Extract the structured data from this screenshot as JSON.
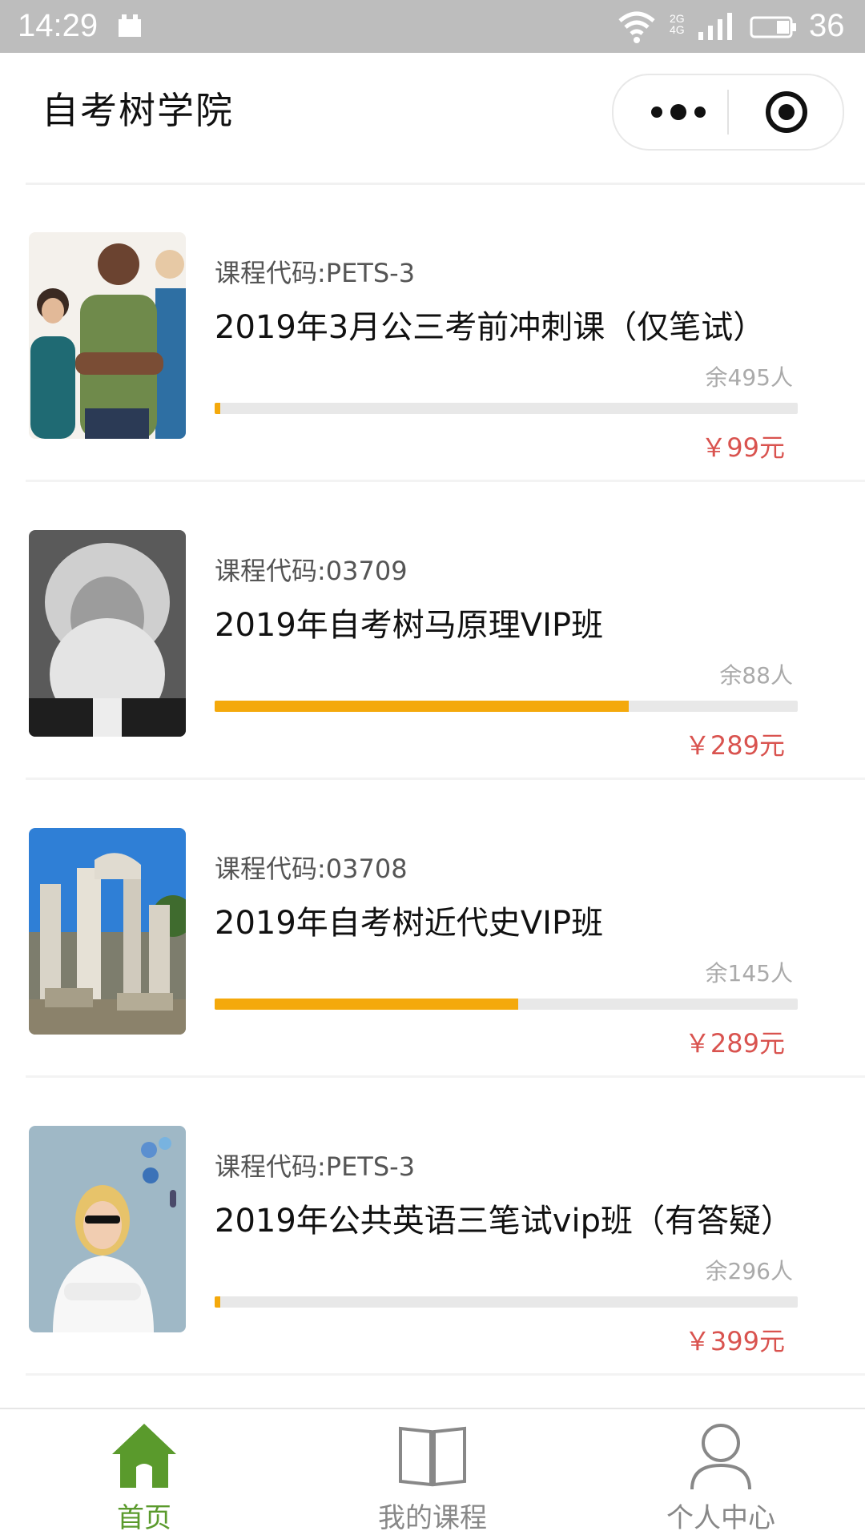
{
  "status_bar": {
    "time": "14:29",
    "network": "2G 4G",
    "battery_level": "36"
  },
  "nav": {
    "title": "自考树学院"
  },
  "courses": [
    {
      "code": "课程代码:PETS-3",
      "title": "2019年3月公三考前冲刺课（仅笔试）",
      "remaining": "余495人",
      "progress": 0.01,
      "price": "￥99元"
    },
    {
      "code": "课程代码:03709",
      "title": "2019年自考树马原理VIP班",
      "remaining": "余88人",
      "progress": 0.71,
      "price": "￥289元"
    },
    {
      "code": "课程代码:03708",
      "title": "2019年自考树近代史VIP班",
      "remaining": "余145人",
      "progress": 0.52,
      "price": "￥289元"
    },
    {
      "code": "课程代码:PETS-3",
      "title": "2019年公共英语三笔试vip班（有答疑）",
      "remaining": "余296人",
      "progress": 0.01,
      "price": "￥399元"
    }
  ],
  "tabbar": {
    "home": "首页",
    "my_courses": "我的课程",
    "profile": "个人中心"
  },
  "colors": {
    "accent_green": "#5a9a2c",
    "progress": "#f4a90c",
    "price": "#d9534f"
  },
  "icons": {
    "home": "house-icon",
    "courses": "book-icon",
    "profile": "person-icon"
  }
}
